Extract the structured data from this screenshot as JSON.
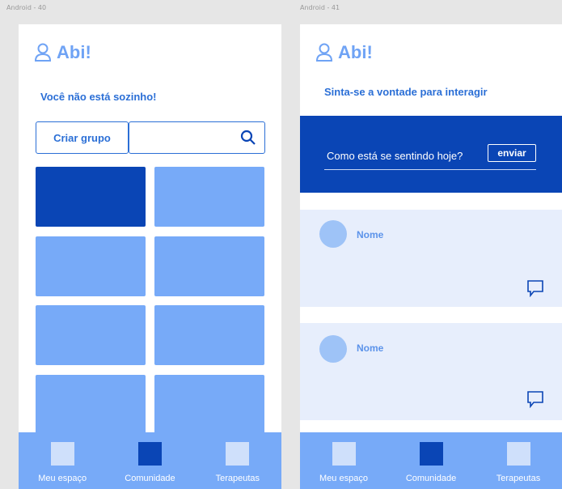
{
  "frames": {
    "left_label": "Android - 40",
    "right_label": "Android - 41"
  },
  "colors": {
    "primary": "#0a45b5",
    "accent": "#2b6fd6",
    "light": "#77aaf8",
    "card_bg": "#e7eefc"
  },
  "screen1": {
    "logo_text": "Abi!",
    "logo_icon": "user-icon",
    "subtitle": "Você não está sozinho!",
    "create_group_label": "Criar grupo",
    "search_icon": "search-icon",
    "tiles_count": 8,
    "active_tile_index": 0
  },
  "screen2": {
    "logo_text": "Abi!",
    "subtitle": "Sinta-se a vontade para interagir",
    "post_prompt": "Como está se sentindo hoje?",
    "send_label": "enviar",
    "posts": [
      {
        "name": "Nome",
        "icon": "comment-icon"
      },
      {
        "name": "Nome",
        "icon": "comment-icon"
      }
    ]
  },
  "nav": {
    "items": [
      {
        "label": "Meu espaço"
      },
      {
        "label": "Comunidade"
      },
      {
        "label": "Terapeutas"
      }
    ],
    "active_index": 1
  }
}
